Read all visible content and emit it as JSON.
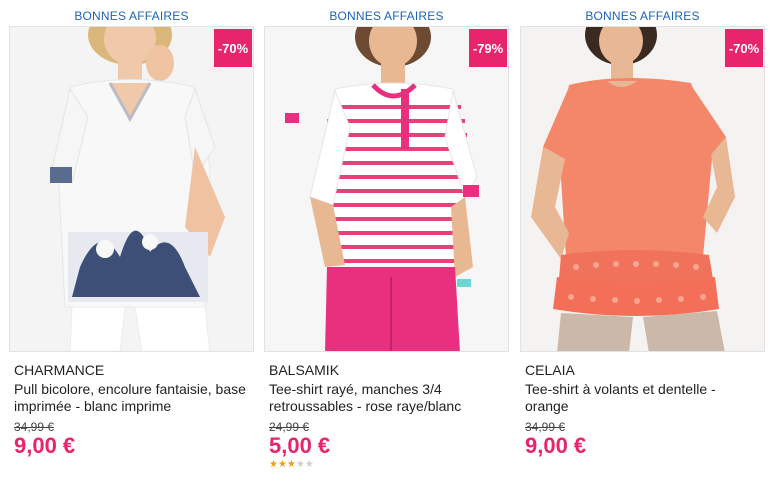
{
  "products": [
    {
      "tag": "BONNES AFFAIRES",
      "discount": "-70%",
      "brand": "CHARMANCE",
      "title": "Pull bicolore, encolure fantaisie, base imprimée - blanc imprime",
      "old_price": "34,99 €",
      "price": "9,00 €",
      "image_icon": "white-printed-sweater-model-photo",
      "colors": {
        "garment": "#f6f6f6",
        "print": "#3d4f77",
        "pants": "#ffffff"
      }
    },
    {
      "tag": "BONNES AFFAIRES",
      "discount": "-79%",
      "brand": "BALSAMIK",
      "title": "Tee-shirt rayé, manches 3/4 retroussables - rose raye/blanc",
      "old_price": "24,99 €",
      "price": "5,00 €",
      "rating": {
        "value": 3,
        "max": 5
      },
      "image_icon": "pink-striped-tee-model-photo",
      "colors": {
        "garment": "#ffffff",
        "stripe": "#e8417a",
        "pants": "#e8307e"
      }
    },
    {
      "tag": "BONNES AFFAIRES",
      "discount": "-70%",
      "brand": "CELAIA",
      "title": "Tee-shirt à volants et dentelle - orange",
      "old_price": "34,99 €",
      "price": "9,00 €",
      "image_icon": "orange-lace-tee-model-photo",
      "colors": {
        "garment": "#f4876a",
        "lace": "#f0725a",
        "pants": "#cbb8a8"
      }
    }
  ],
  "accent_color": "#e8246c",
  "tag_color": "#1e64b4"
}
